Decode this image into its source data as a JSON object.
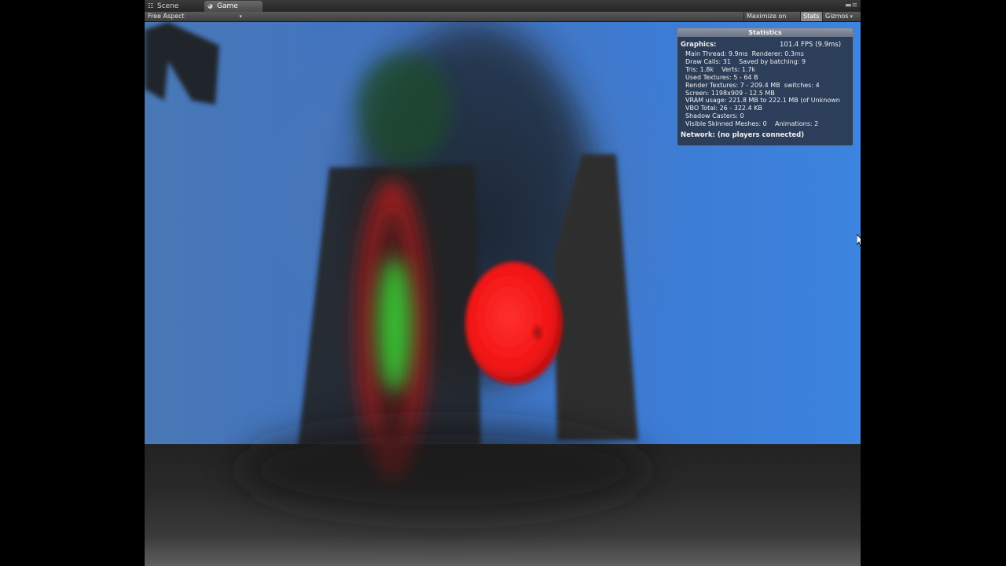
{
  "tabs": {
    "scene": {
      "label": "Scene",
      "icon": "scene-icon"
    },
    "game": {
      "label": "Game",
      "icon": "game-icon"
    },
    "menu_icon": "window-menu-icon"
  },
  "toolbar": {
    "aspect": "Free Aspect",
    "maximize_on_play": "Maximize on Play",
    "stats": "Stats",
    "gizmos": "Gizmos"
  },
  "statistics": {
    "title": "Statistics",
    "graphics_label": "Graphics:",
    "fps": "101.4 FPS (9.9ms)",
    "lines": {
      "main_thread": "Main Thread: 9.9ms",
      "renderer": "Renderer: 0.3ms",
      "draw_calls": "Draw Calls: 31",
      "saved_by_batching": "Saved by batching: 9",
      "tris": "Tris: 1.8k",
      "verts": "Verts: 1.7k",
      "used_textures": "Used Textures: 5 - 64 B",
      "render_textures": "Render Textures: 7 - 209.4 MB",
      "switches": "switches: 4",
      "screen": "Screen: 1198x909 - 12.5 MB",
      "vram": "VRAM usage: 221.8 MB to 222.1 MB (of Unknown",
      "vbo": "VBO Total: 26 - 322.4 KB",
      "shadow_casters": "Shadow Casters: 0",
      "visible_skinned": "Visible Skinned Meshes: 0",
      "animations": "Animations: 2"
    },
    "network": "Network: (no players connected)"
  },
  "colors": {
    "sky": "#3f78d0",
    "floor": "#2a2a2a",
    "sphere": "#ff1a1a",
    "glow_green": "#35d335",
    "glow_red": "#d41e1e",
    "panel_bg": "#282c34"
  }
}
